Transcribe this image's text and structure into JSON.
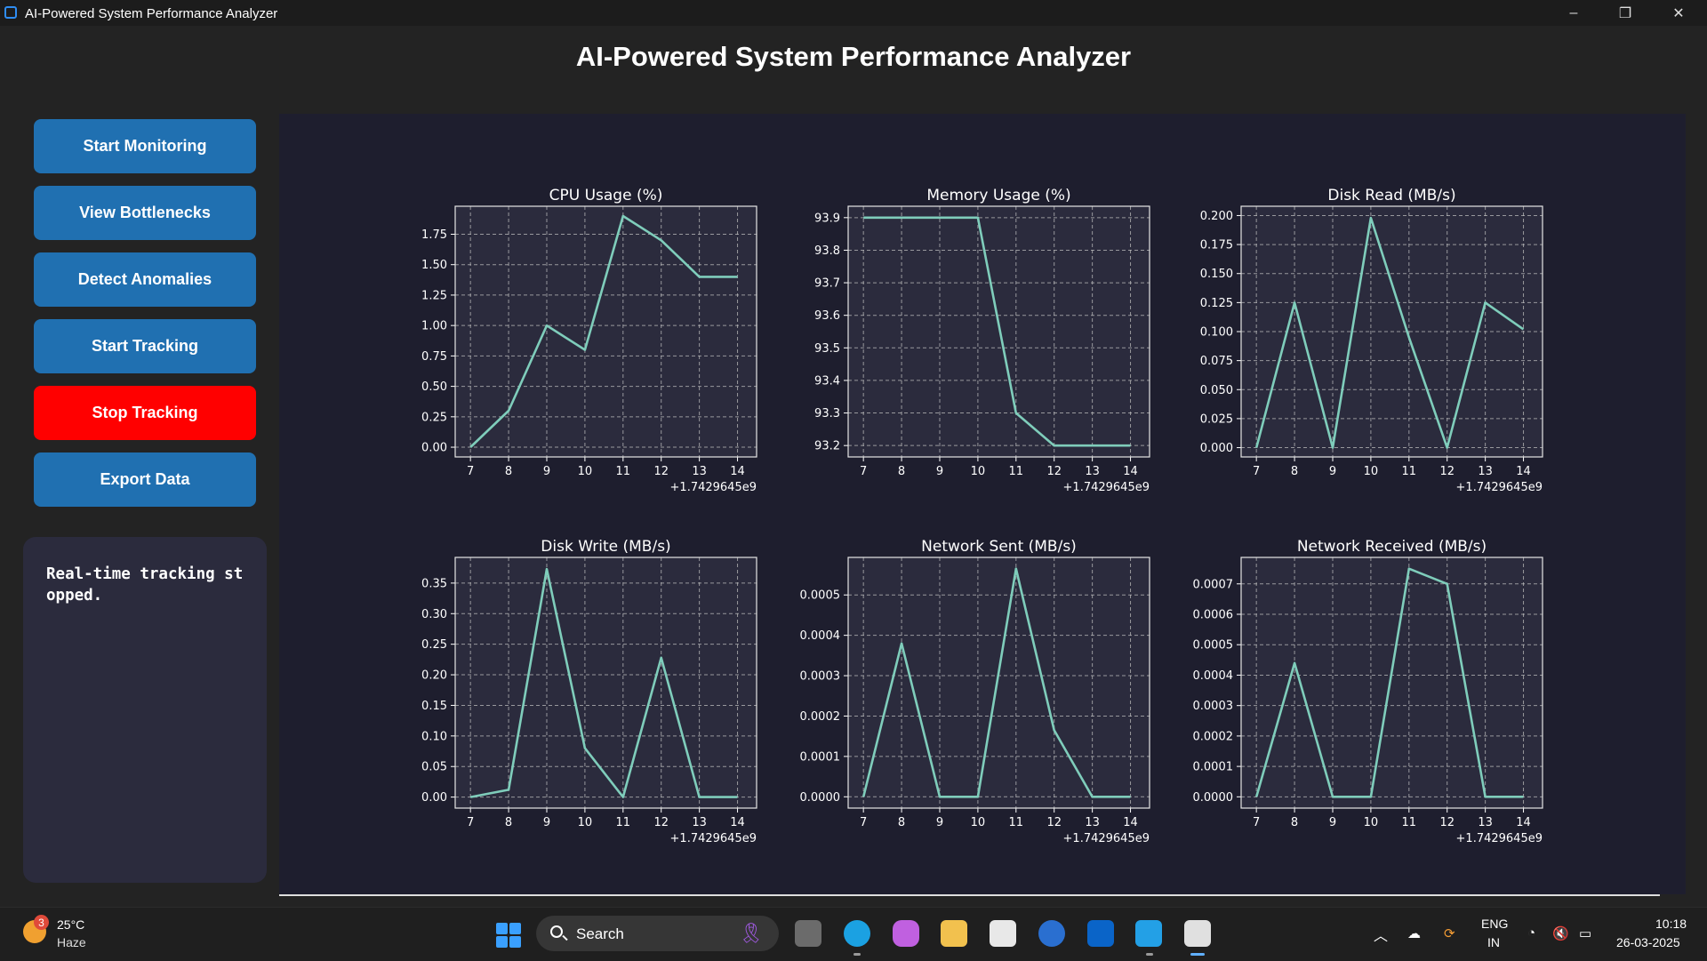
{
  "window": {
    "title": "AI-Powered System Performance Analyzer",
    "minimize": "–",
    "maximize": "❐",
    "close": "✕"
  },
  "header": {
    "title": "AI-Powered System Performance Analyzer"
  },
  "sidebar": {
    "buttons": [
      {
        "label": "Start Monitoring"
      },
      {
        "label": "View Bottlenecks"
      },
      {
        "label": "Detect Anomalies"
      },
      {
        "label": "Start Tracking"
      },
      {
        "label": "Stop Tracking"
      },
      {
        "label": "Export Data"
      }
    ],
    "status_text": "Real-time tracking stopped."
  },
  "colors": {
    "accent": "#2070b1",
    "stop": "#ff0000",
    "line": "#7fcdbb",
    "plot_bg": "#2b2b3d",
    "area_bg": "#1e1e2e"
  },
  "chart_data": [
    {
      "type": "line",
      "title": "CPU Usage (%)",
      "x": [
        7,
        8,
        9,
        10,
        11,
        12,
        13,
        14
      ],
      "values": [
        0.0,
        0.3,
        1.0,
        0.8,
        1.9,
        1.7,
        1.4,
        1.4
      ],
      "xlim": [
        6.6,
        14.5
      ],
      "ylim": [
        -0.08,
        1.98
      ],
      "yticks": [
        "0.00",
        "0.25",
        "0.50",
        "0.75",
        "1.00",
        "1.25",
        "1.50",
        "1.75"
      ],
      "ytick_values": [
        0,
        0.25,
        0.5,
        0.75,
        1.0,
        1.25,
        1.5,
        1.75
      ],
      "xticks": [
        "7",
        "8",
        "9",
        "10",
        "11",
        "12",
        "13",
        "14"
      ],
      "offset": "+1.7429645e9",
      "grid": true
    },
    {
      "type": "line",
      "title": "Memory Usage (%)",
      "x": [
        7,
        8,
        9,
        10,
        11,
        12,
        13,
        14
      ],
      "values": [
        93.9,
        93.9,
        93.9,
        93.9,
        93.3,
        93.2,
        93.2,
        93.2
      ],
      "xlim": [
        6.6,
        14.5
      ],
      "ylim": [
        93.165,
        93.935
      ],
      "yticks": [
        "93.2",
        "93.3",
        "93.4",
        "93.5",
        "93.6",
        "93.7",
        "93.8",
        "93.9"
      ],
      "ytick_values": [
        93.2,
        93.3,
        93.4,
        93.5,
        93.6,
        93.7,
        93.8,
        93.9
      ],
      "xticks": [
        "7",
        "8",
        "9",
        "10",
        "11",
        "12",
        "13",
        "14"
      ],
      "offset": "+1.7429645e9",
      "grid": true
    },
    {
      "type": "line",
      "title": "Disk Read (MB/s)",
      "x": [
        7,
        8,
        9,
        10,
        11,
        12,
        13,
        14
      ],
      "values": [
        0.0,
        0.125,
        0.0,
        0.198,
        0.095,
        0.0,
        0.125,
        0.102
      ],
      "xlim": [
        6.6,
        14.5
      ],
      "ylim": [
        -0.008,
        0.208
      ],
      "yticks": [
        "0.000",
        "0.025",
        "0.050",
        "0.075",
        "0.100",
        "0.125",
        "0.150",
        "0.175",
        "0.200"
      ],
      "ytick_values": [
        0,
        0.025,
        0.05,
        0.075,
        0.1,
        0.125,
        0.15,
        0.175,
        0.2
      ],
      "xticks": [
        "7",
        "8",
        "9",
        "10",
        "11",
        "12",
        "13",
        "14"
      ],
      "offset": "+1.7429645e9",
      "grid": true
    },
    {
      "type": "line",
      "title": "Disk Write (MB/s)",
      "x": [
        7,
        8,
        9,
        10,
        11,
        12,
        13,
        14
      ],
      "values": [
        0.0,
        0.012,
        0.373,
        0.08,
        0.0,
        0.228,
        0.0,
        0.0
      ],
      "xlim": [
        6.6,
        14.5
      ],
      "ylim": [
        -0.018,
        0.392
      ],
      "yticks": [
        "0.00",
        "0.05",
        "0.10",
        "0.15",
        "0.20",
        "0.25",
        "0.30",
        "0.35"
      ],
      "ytick_values": [
        0,
        0.05,
        0.1,
        0.15,
        0.2,
        0.25,
        0.3,
        0.35
      ],
      "xticks": [
        "7",
        "8",
        "9",
        "10",
        "11",
        "12",
        "13",
        "14"
      ],
      "offset": "+1.7429645e9",
      "grid": true
    },
    {
      "type": "line",
      "title": "Network Sent (MB/s)",
      "x": [
        7,
        8,
        9,
        10,
        11,
        12,
        13,
        14
      ],
      "values": [
        0.0,
        0.00038,
        0.0,
        0.0,
        0.000565,
        0.000165,
        0.0,
        0.0
      ],
      "xlim": [
        6.6,
        14.5
      ],
      "ylim": [
        -2.8e-05,
        0.000593
      ],
      "yticks": [
        "0.0000",
        "0.0001",
        "0.0002",
        "0.0003",
        "0.0004",
        "0.0005"
      ],
      "ytick_values": [
        0,
        0.0001,
        0.0002,
        0.0003,
        0.0004,
        0.0005
      ],
      "xticks": [
        "7",
        "8",
        "9",
        "10",
        "11",
        "12",
        "13",
        "14"
      ],
      "offset": "+1.7429645e9",
      "grid": true
    },
    {
      "type": "line",
      "title": "Network Received (MB/s)",
      "x": [
        7,
        8,
        9,
        10,
        11,
        12,
        13,
        14
      ],
      "values": [
        0.0,
        0.00044,
        0.0,
        0.0,
        0.00075,
        0.0007,
        0.0,
        0.0
      ],
      "xlim": [
        6.6,
        14.5
      ],
      "ylim": [
        -3.7e-05,
        0.000787
      ],
      "yticks": [
        "0.0000",
        "0.0001",
        "0.0002",
        "0.0003",
        "0.0004",
        "0.0005",
        "0.0006",
        "0.0007"
      ],
      "ytick_values": [
        0,
        0.0001,
        0.0002,
        0.0003,
        0.0004,
        0.0005,
        0.0006,
        0.0007
      ],
      "xticks": [
        "7",
        "8",
        "9",
        "10",
        "11",
        "12",
        "13",
        "14"
      ],
      "offset": "+1.7429645e9",
      "grid": true
    }
  ],
  "taskbar": {
    "weather": {
      "temp": "25°C",
      "condition": "Haze",
      "badge": "3"
    },
    "search": {
      "label": "Search"
    },
    "apps": [
      "task-view-icon",
      "edge-icon",
      "copilot-icon",
      "file-explorer-icon",
      "store-icon",
      "dell-icon",
      "outlook-icon",
      "vscode-icon",
      "python-icon"
    ],
    "lang": {
      "line1": "ENG",
      "line2": "IN"
    },
    "clock": {
      "time": "10:18",
      "date": "26-03-2025"
    }
  }
}
